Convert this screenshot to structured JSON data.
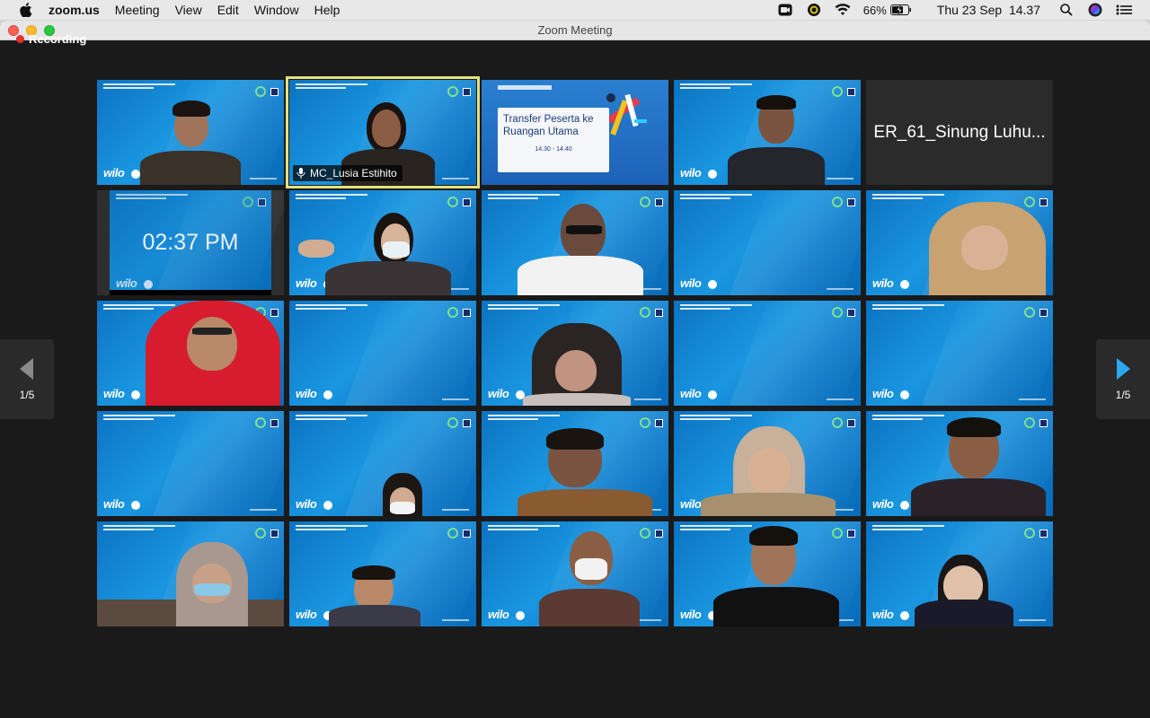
{
  "menubar": {
    "app_name": "zoom.us",
    "items": [
      "Meeting",
      "View",
      "Edit",
      "Window",
      "Help"
    ],
    "battery": "66%",
    "datetime": "Thu 23 Sep  14.37"
  },
  "window": {
    "title": "Zoom Meeting",
    "recording_label": "Recording"
  },
  "navigation": {
    "left_page": "1/5",
    "right_page": "1/5"
  },
  "tiles": {
    "active_speaker_name": "MC_Lusia Estihito",
    "name_only_participant": "ER_61_Sinung Luhu...",
    "clock_time": "02:37 PM",
    "transfer_title": "Transfer Peserta ke Ruangan Utama",
    "transfer_time": "14.30 - 14.40"
  },
  "colors": {
    "active_border": "#e3e17c",
    "recording_dot": "#e8302f",
    "nav_arrow_right": "#2ba9f0"
  }
}
